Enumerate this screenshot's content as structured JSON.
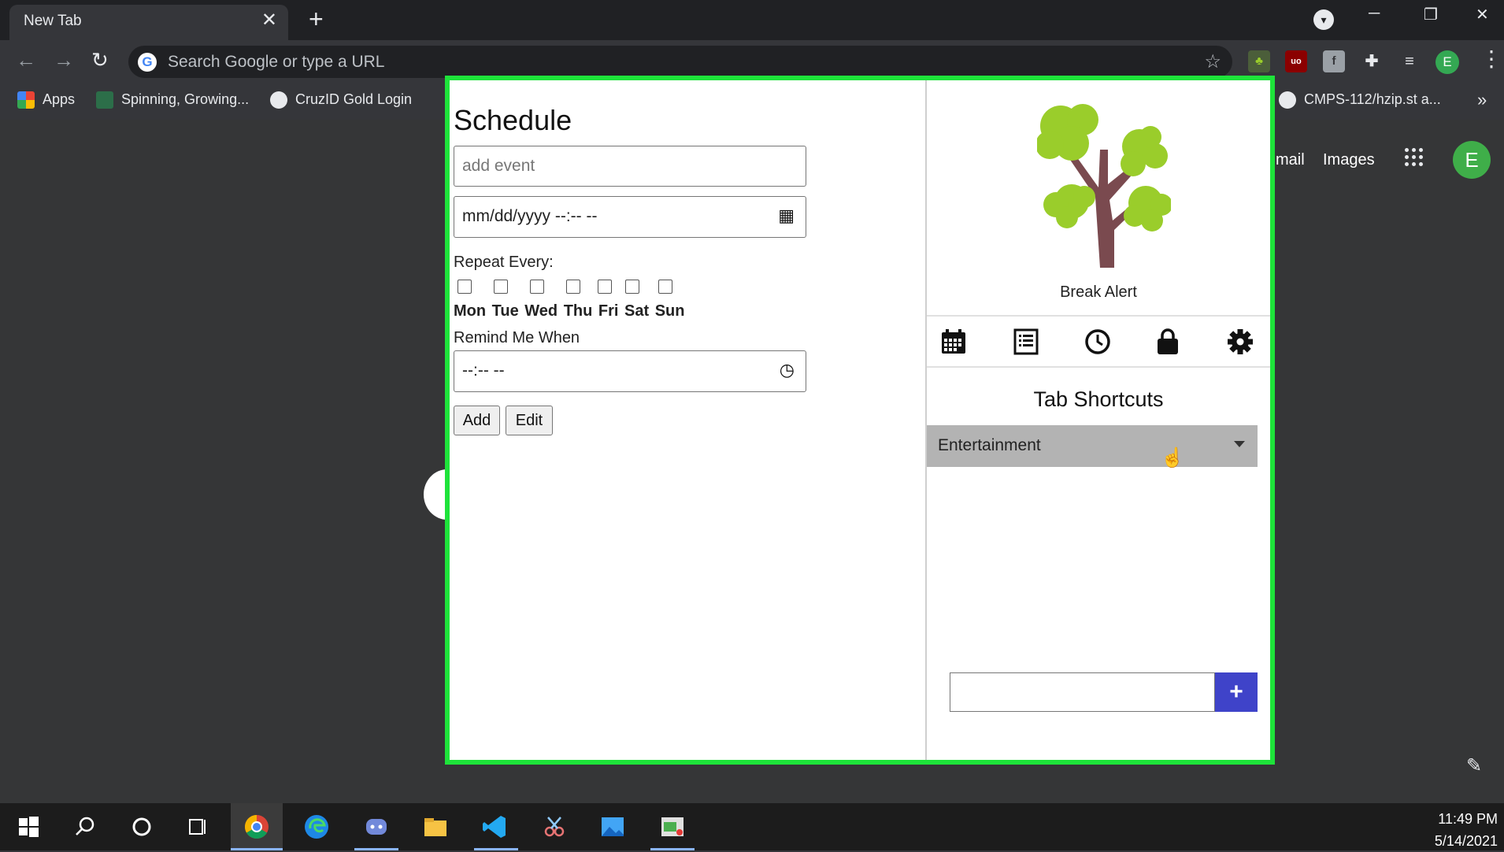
{
  "browser": {
    "tab_title": "New Tab",
    "tab_close": "✕",
    "new_tab": "+",
    "omnibox_placeholder": "Search Google or type a URL",
    "profile_initial": "E",
    "bookmarks": [
      {
        "label": "Apps"
      },
      {
        "label": "Spinning, Growing..."
      },
      {
        "label": "CruzID Gold Login"
      },
      {
        "label": "CMPS-112/hzip.st a..."
      }
    ],
    "bookmarks_more": "»"
  },
  "ntp": {
    "gmail_label": "mail",
    "images_label": "Images",
    "avatar_initial": "E"
  },
  "schedule": {
    "title": "Schedule",
    "event_placeholder": "add event",
    "datetime_placeholder": "mm/dd/yyyy  --:-- --",
    "repeat_label": "Repeat Every:",
    "days": "Mon Tue Wed Thu Fri Sat Sun",
    "remind_label": "Remind Me When",
    "time_placeholder": "--:-- --",
    "add_button": "Add",
    "edit_button": "Edit"
  },
  "break_alert": {
    "title": "Break Alert",
    "nav_icons": [
      "calendar-icon",
      "list-icon",
      "clock-icon",
      "lock-icon",
      "gear-icon"
    ],
    "shortcuts_title": "Tab Shortcuts",
    "dropdown_selected": "Entertainment",
    "add_symbol": "+"
  },
  "taskbar": {
    "time": "11:49 PM",
    "date": "5/14/2021"
  },
  "colors": {
    "popup_border": "#1ee33a",
    "add_button": "#3f43c9",
    "tree_leaves": "#9acd2b",
    "tree_trunk": "#7a4a4f"
  }
}
